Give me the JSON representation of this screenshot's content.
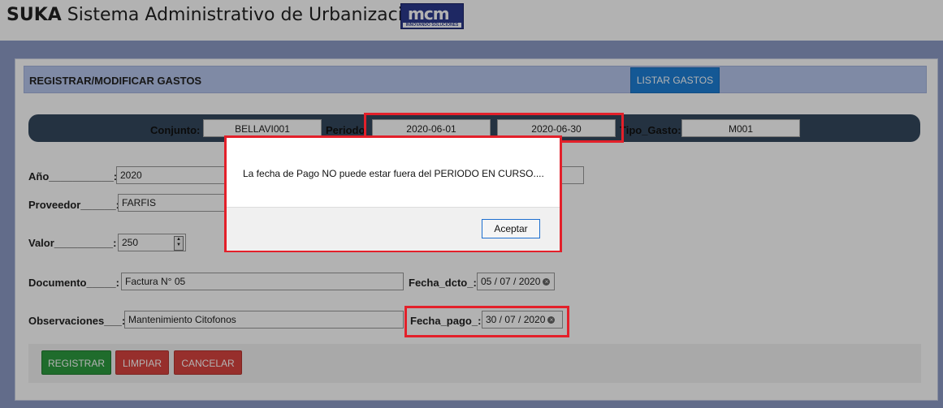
{
  "header": {
    "brand": "SUKA",
    "title": "Sistema Administrativo de Urbanizaciones",
    "logo_mark": "mcm",
    "logo_tagline": "INNOVANDO SOLUCIONES"
  },
  "panel": {
    "title": "REGISTRAR/MODIFICAR GASTOS",
    "list_button": "LISTAR GASTOS"
  },
  "filters": {
    "conjunto_label": "Conjunto:",
    "conjunto_value": "BELLAVI001",
    "periodo_label": "Periodo",
    "periodo_start": "2020-06-01",
    "periodo_end": "2020-06-30",
    "tipo_label": "Tipo_Gasto:",
    "tipo_value": "M001"
  },
  "form": {
    "anio_label": "Año___________:",
    "anio_value": "2020",
    "proveedor_label": "Proveedor______:",
    "proveedor_value": "FARFIS",
    "valor_label": "Valor__________:",
    "valor_value": "250",
    "documento_label": "Documento_____:",
    "documento_value": "Factura N° 05",
    "fecha_dcto_label": "Fecha_dcto_:",
    "fecha_dcto_value": "05 / 07 / 2020",
    "observaciones_label": "Observaciones___:",
    "observaciones_value": "Mantenimiento Citofonos",
    "fecha_pago_label": "Fecha_pago_:",
    "fecha_pago_value": "30 / 07 / 2020"
  },
  "actions": {
    "registrar": "REGISTRAR",
    "limpiar": "LIMPIAR",
    "cancelar": "CANCELAR"
  },
  "dialog": {
    "message": "La fecha de Pago NO puede estar fuera del PERIODO EN CURSO....",
    "ok_label": "Aceptar"
  },
  "colors": {
    "highlight": "#e3202a",
    "primary": "#1e7fd6",
    "success": "#2d9b3f",
    "danger": "#d9443f"
  }
}
